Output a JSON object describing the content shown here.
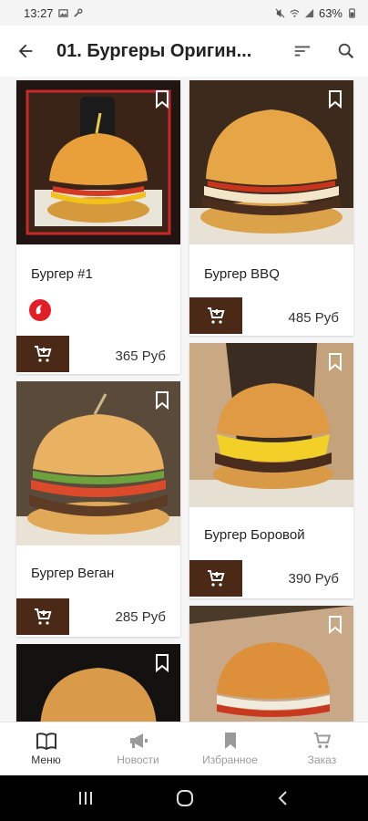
{
  "status_bar": {
    "time": "13:27",
    "battery": "63%"
  },
  "app_bar": {
    "title": "01. Бургеры Оригин..."
  },
  "products": [
    {
      "name": "Бургер #1",
      "price": "365 Руб",
      "badge": "hot-pepper-icon"
    },
    {
      "name": "Бургер BBQ",
      "price": "485 Руб"
    },
    {
      "name": "Бургер Веган",
      "price": "285 Руб"
    },
    {
      "name": "Бургер Боровой",
      "price": "390 Руб"
    }
  ],
  "bottom_nav": [
    {
      "label": "Меню",
      "icon": "book-icon",
      "active": true
    },
    {
      "label": "Новости",
      "icon": "megaphone-icon"
    },
    {
      "label": "Избранное",
      "icon": "bookmark-icon"
    },
    {
      "label": "Заказ",
      "icon": "cart-icon"
    }
  ],
  "colors": {
    "cart_button": "#4a2a17",
    "hot_badge": "#e21f26",
    "active_tab": "#333333",
    "inactive_tab": "#9a9a9a"
  }
}
